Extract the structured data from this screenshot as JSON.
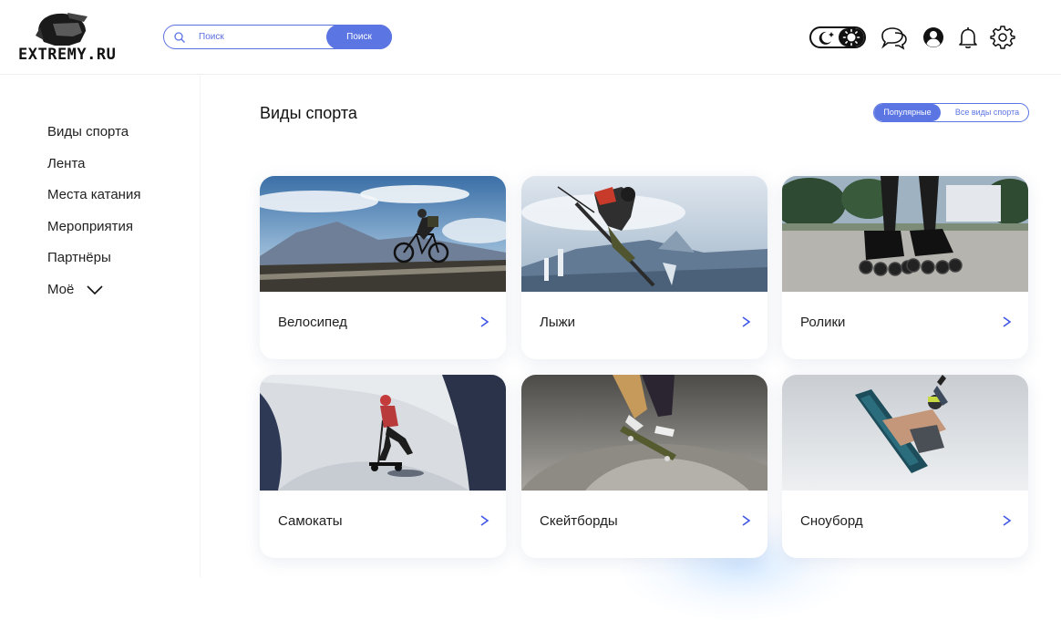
{
  "header": {
    "logo_text": "EXTREMY.RU",
    "search": {
      "placeholder": "Поиск",
      "button_label": "Поиск"
    }
  },
  "sidebar": {
    "items": [
      {
        "label": "Виды спорта"
      },
      {
        "label": "Лента"
      },
      {
        "label": "Места катания"
      },
      {
        "label": "Мероприятия"
      },
      {
        "label": "Партнёры"
      },
      {
        "label": "Моё"
      }
    ]
  },
  "main": {
    "title": "Виды спорта",
    "filter": {
      "active": "Популярные",
      "other": "Все виды спорта"
    },
    "cards": [
      {
        "label": "Велосипед",
        "icon": "cyclist-photo"
      },
      {
        "label": "Лыжи",
        "icon": "skier-photo"
      },
      {
        "label": "Ролики",
        "icon": "rollerblades-photo"
      },
      {
        "label": "Самокаты",
        "icon": "scooter-photo"
      },
      {
        "label": "Скейтборды",
        "icon": "skateboard-photo"
      },
      {
        "label": "Сноуборд",
        "icon": "snowboard-photo"
      }
    ]
  },
  "colors": {
    "accent": "#5b75e3",
    "arrow_start": "#a24be0",
    "arrow_end": "#3f56e6"
  }
}
